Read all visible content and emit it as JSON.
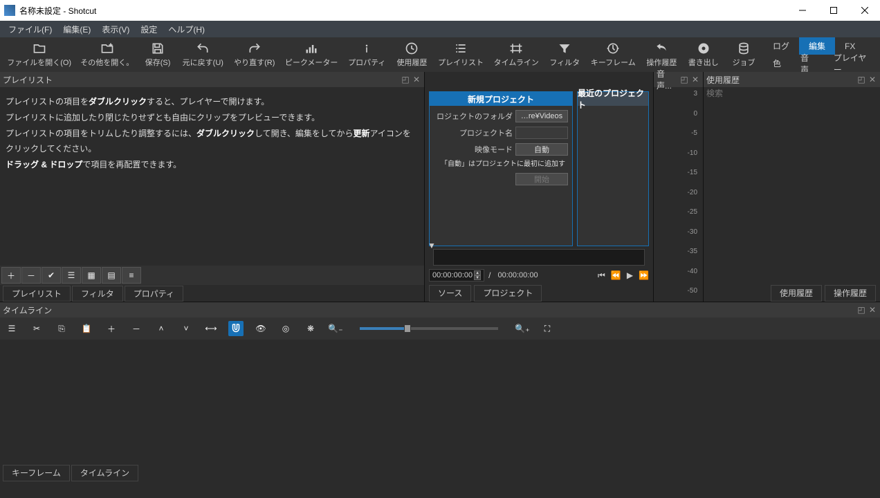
{
  "title": "名称未設定 - Shotcut",
  "menubar": [
    "ファイル(F)",
    "編集(E)",
    "表示(V)",
    "設定",
    "ヘルプ(H)"
  ],
  "toolbar": [
    {
      "label": "ファイルを開く(O)",
      "icon": "folder"
    },
    {
      "label": "その他を開く。",
      "icon": "folder-plus"
    },
    {
      "label": "保存(S)",
      "icon": "save"
    },
    {
      "label": "元に戻す(U)",
      "icon": "undo"
    },
    {
      "label": "やり直す(R)",
      "icon": "redo"
    },
    {
      "label": "ピークメーター",
      "icon": "meter"
    },
    {
      "label": "プロパティ",
      "icon": "info"
    },
    {
      "label": "使用履歴",
      "icon": "clock"
    },
    {
      "label": "プレイリスト",
      "icon": "list"
    },
    {
      "label": "タイムライン",
      "icon": "timeline"
    },
    {
      "label": "フィルタ",
      "icon": "filter"
    },
    {
      "label": "キーフレーム",
      "icon": "keyframe"
    },
    {
      "label": "操作履歴",
      "icon": "history"
    },
    {
      "label": "書き出し",
      "icon": "export"
    },
    {
      "label": "ジョブ",
      "icon": "jobs"
    }
  ],
  "rightStack": {
    "row1": [
      "ログ",
      "編集",
      "FX"
    ],
    "row2": [
      "色",
      "音声",
      "プレイヤー"
    ],
    "active": "編集"
  },
  "playlist": {
    "title": "プレイリスト",
    "lines": [
      {
        "t": "プレイリストの項目を",
        "b": "ダブルクリック",
        "t2": "すると、プレイヤーで開けます。"
      },
      {
        "t": "プレイリストに追加したり閉じたりせずとも自由にクリップをプレビューできます。"
      },
      {
        "t": "プレイリストの項目をトリムしたり調整するには、",
        "b": "ダブルクリック",
        "t2": "して開き、編集をしてから",
        "b2": "更新",
        "t3": "アイコンをクリックしてください。"
      },
      {
        "b": "ドラッグ & ドロップ",
        "t2": "で項目を再配置できます。"
      }
    ],
    "tabs": [
      "プレイリスト",
      "フィルタ",
      "プロパティ"
    ]
  },
  "project": {
    "newTitle": "新規プロジェクト",
    "recentTitle": "最近のプロジェクト",
    "folderLabel": "ロジェクトのフォルダ",
    "folderValue": "…re¥Videos",
    "nameLabel": "プロジェクト名",
    "nameValue": "",
    "modeLabel": "映像モード",
    "modeValue": "自動",
    "desc": "「自動」はプロジェクトに最初に追加す",
    "startLabel": "開始"
  },
  "transport": {
    "current": "00:00:00:00",
    "total": "00:00:00:00",
    "tabs": [
      "ソース",
      "プロジェクト"
    ]
  },
  "audio": {
    "title": "音声...",
    "scale": [
      "3",
      "0",
      "-5",
      "-10",
      "-15",
      "-20",
      "-25",
      "-30",
      "-35",
      "-40",
      "-50"
    ]
  },
  "history": {
    "title": "使用履歴",
    "searchPlaceholder": "検索",
    "tabs": [
      "使用履歴",
      "操作履歴"
    ]
  },
  "timeline": {
    "title": "タイムライン",
    "bottomTabs": [
      "キーフレーム",
      "タイムライン"
    ]
  }
}
